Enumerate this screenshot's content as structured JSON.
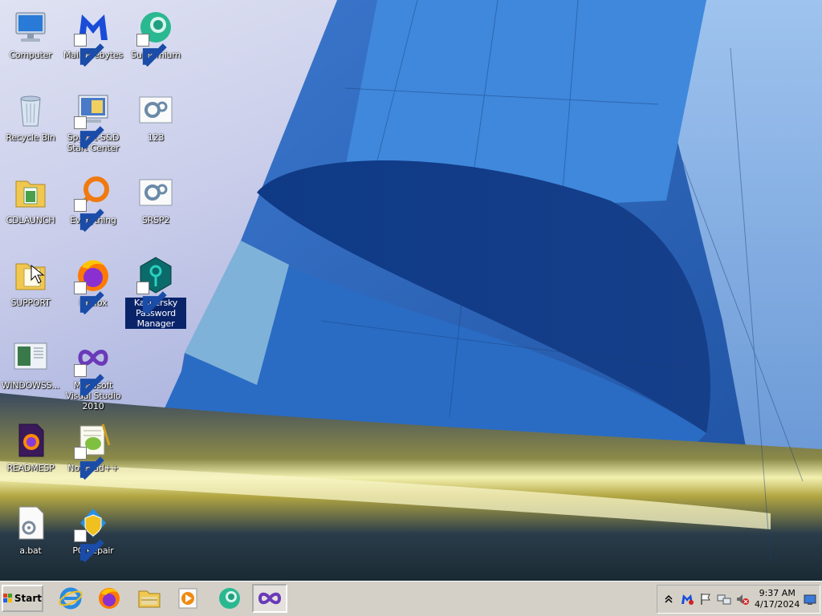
{
  "desktop": {
    "icons": [
      {
        "label": "Computer"
      },
      {
        "label": "Malwarebytes"
      },
      {
        "label": "Supermium"
      },
      {
        "label": "Recycle Bin"
      },
      {
        "label": "Spybot-S&D Start Center"
      },
      {
        "label": "123"
      },
      {
        "label": "CDLAUNCH"
      },
      {
        "label": "Everything"
      },
      {
        "label": "SRSP2"
      },
      {
        "label": "SUPPORT"
      },
      {
        "label": "Firefox"
      },
      {
        "label": "Kaspersky Password Manager"
      },
      {
        "label": "WINDOWSS..."
      },
      {
        "label": "Microsoft Visual Studio 2010"
      },
      {
        "label": "READMESP"
      },
      {
        "label": "Notepad++"
      },
      {
        "label": "a.bat"
      },
      {
        "label": "PC Repair"
      }
    ]
  },
  "taskbar": {
    "start_label": "Start",
    "pinned": [
      "internet-explorer-icon",
      "firefox-icon",
      "file-explorer-icon",
      "media-player-icon",
      "supermium-icon",
      "visual-studio-icon"
    ],
    "tray_icons": [
      "show-hidden-icons-chevron",
      "malwarebytes-tray-icon",
      "action-center-flag-icon",
      "network-icon",
      "volume-muted-icon",
      "show-desktop-icon"
    ],
    "clock": {
      "time": "9:37 AM",
      "date": "4/17/2024"
    }
  },
  "colors": {
    "taskbar": "#d4d0c8",
    "selection": "#0a246a"
  }
}
